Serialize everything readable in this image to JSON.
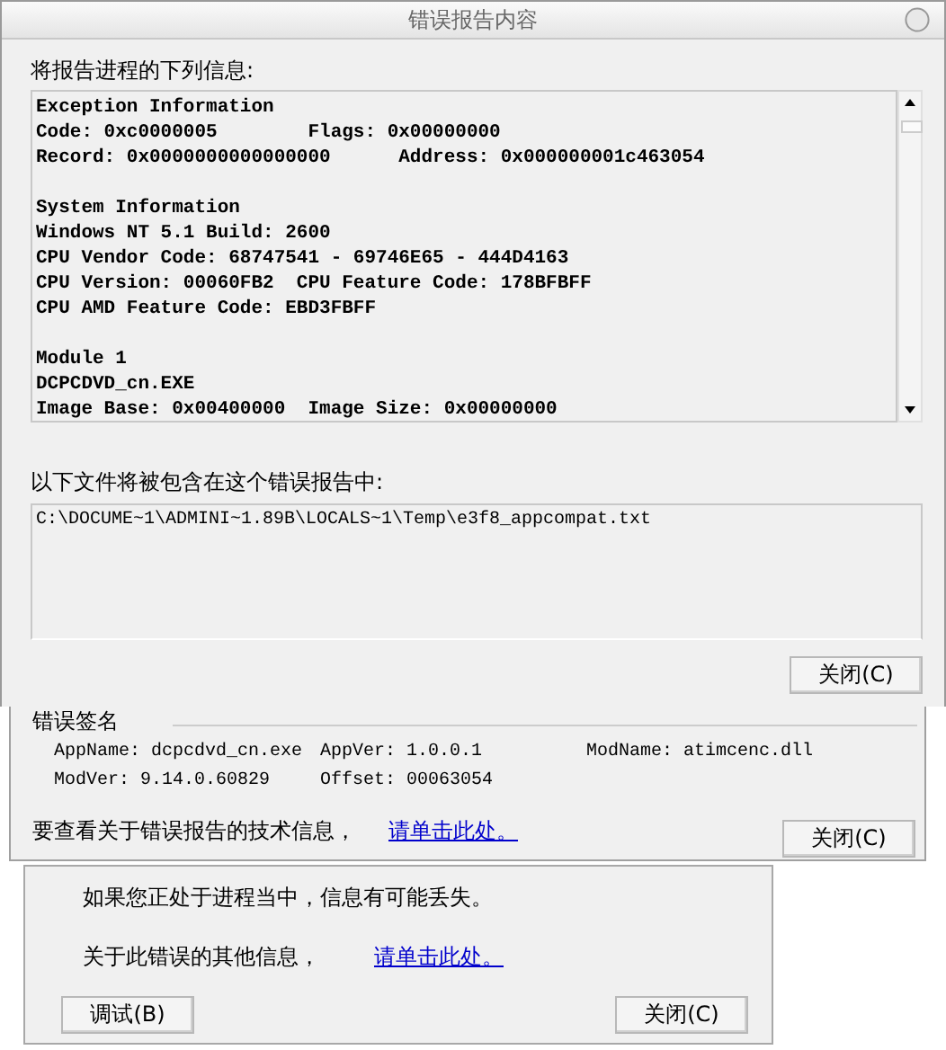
{
  "report_window": {
    "title": "错误报告内容",
    "report_label": "将报告进程的下列信息:",
    "report_sections": [
      [
        "Exception Information",
        "Code: 0xc0000005        Flags: 0x00000000",
        "Record: 0x0000000000000000      Address: 0x000000001c463054"
      ],
      [
        "System Information",
        "Windows NT 5.1 Build: 2600",
        "CPU Vendor Code: 68747541 - 69746E65 - 444D4163",
        "CPU Version: 00060FB2  CPU Feature Code: 178BFBFF",
        "CPU AMD Feature Code: EBD3FBFF"
      ],
      [
        "Module 1",
        "DCPCDVD_cn.EXE",
        "Image Base: 0x00400000  Image Size: 0x00000000"
      ]
    ],
    "files_label": "以下文件将被包含在这个错误报告中:",
    "files": [
      "C:\\DOCUME~1\\ADMINI~1.89B\\LOCALS~1\\Temp\\e3f8_appcompat.txt"
    ],
    "close_button": "关闭(C)"
  },
  "signature_window": {
    "group_title": "错误签名",
    "fields": [
      "AppName: dcpcdvd_cn.exe",
      "AppVer: 1.0.0.1",
      "ModName: atimcenc.dll",
      "ModVer: 9.14.0.60829",
      "Offset: 00063054"
    ],
    "tech_info_text": "要查看关于错误报告的技术信息，",
    "tech_info_link": "请单击此处。",
    "close_button": "关闭(C)"
  },
  "error_dialog": {
    "warning_text": "如果您正处于进程当中，信息有可能丢失。",
    "more_info_text": "关于此错误的其他信息，",
    "more_info_link": "请单击此处。",
    "buttons": [
      {
        "kind": "debug",
        "label": "调试(B)"
      },
      {
        "kind": "close",
        "label": "关闭(C)"
      }
    ]
  }
}
